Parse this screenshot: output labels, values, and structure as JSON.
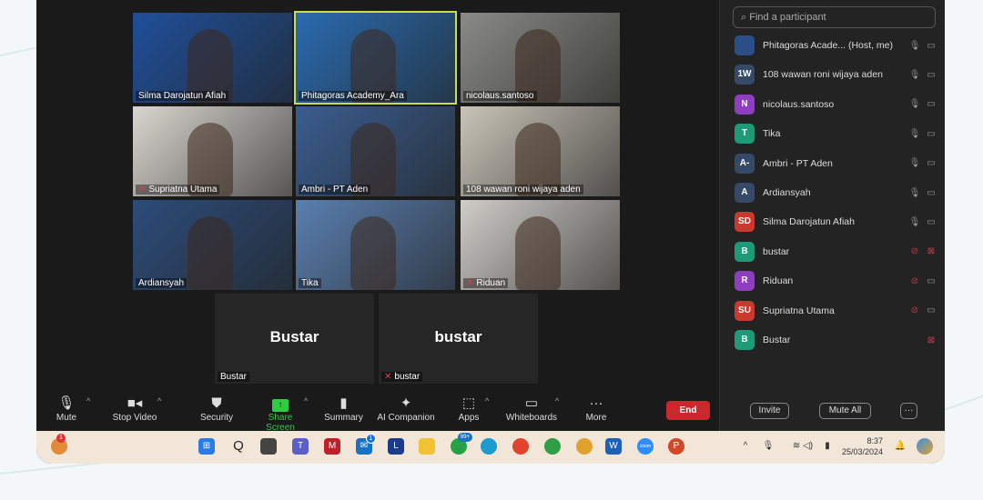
{
  "tiles": [
    {
      "name": "Silma Darojatun Afiah",
      "bg": "#1f4f9a",
      "muted": false
    },
    {
      "name": "Phitagoras Academy_Ara",
      "bg": "#2a6bb0",
      "muted": false,
      "active": true
    },
    {
      "name": "nicolaus.santoso",
      "bg": "#8a8a86",
      "muted": false
    },
    {
      "name": "Supriatna Utama",
      "bg": "#d9d6cf",
      "muted": true
    },
    {
      "name": "Ambri - PT Aden",
      "bg": "#3a5d8f",
      "muted": false
    },
    {
      "name": "108 wawan roni wijaya aden",
      "bg": "#c9c4b8",
      "muted": false
    },
    {
      "name": "Ardiansyah",
      "bg": "#2c4c7a",
      "muted": false
    },
    {
      "name": "Tika",
      "bg": "#5a7fb0",
      "muted": false
    },
    {
      "name": "Riduan",
      "bg": "#d0cdc8",
      "muted": true
    }
  ],
  "dark_tiles": [
    {
      "big": "Bustar",
      "name": "Bustar",
      "muted": false
    },
    {
      "big": "bustar",
      "name": "bustar",
      "muted": true
    }
  ],
  "toolbar": {
    "mute": "Mute",
    "stop_video": "Stop Video",
    "security": "Security",
    "share_screen": "Share Screen",
    "summary": "Summary",
    "ai_companion": "AI Companion",
    "apps": "Apps",
    "whiteboards": "Whiteboards",
    "more": "More",
    "end": "End"
  },
  "panel": {
    "search_placeholder": "Find a participant",
    "participants": [
      {
        "initials": "",
        "name": "Phitagoras Acade...  (Host, me)",
        "color": "#2b4f86",
        "mic": "on",
        "video": "on"
      },
      {
        "initials": "1W",
        "name": "108 wawan roni wijaya aden",
        "color": "#344a66",
        "mic": "on",
        "video": "on"
      },
      {
        "initials": "N",
        "name": "nicolaus.santoso",
        "color": "#8e3fbf",
        "mic": "on",
        "video": "on"
      },
      {
        "initials": "T",
        "name": "Tika",
        "color": "#1f9a78",
        "mic": "on",
        "video": "on"
      },
      {
        "initials": "A-",
        "name": "Ambri - PT Aden",
        "color": "#344a66",
        "mic": "on",
        "video": "on"
      },
      {
        "initials": "A",
        "name": "Ardiansyah",
        "color": "#344a66",
        "mic": "on",
        "video": "on"
      },
      {
        "initials": "SD",
        "name": "Silma Darojatun Afiah",
        "color": "#c93a2e",
        "mic": "on",
        "video": "on"
      },
      {
        "initials": "B",
        "name": "bustar",
        "color": "#1f9a78",
        "mic": "off",
        "video": "off"
      },
      {
        "initials": "R",
        "name": "Riduan",
        "color": "#8e3fbf",
        "mic": "off",
        "video": "on"
      },
      {
        "initials": "SU",
        "name": "Supriatna Utama",
        "color": "#c93a2e",
        "mic": "off",
        "video": "on"
      },
      {
        "initials": "B",
        "name": "Bustar",
        "color": "#1f9a78",
        "mic": "none",
        "video": "off"
      }
    ],
    "invite": "Invite",
    "mute_all": "Mute All",
    "more": "···"
  },
  "taskbar": {
    "time": "8:37",
    "date": "25/03/2024",
    "badges": {
      "notif": "1",
      "outlook": "1",
      "whatsapp": "99+"
    }
  }
}
